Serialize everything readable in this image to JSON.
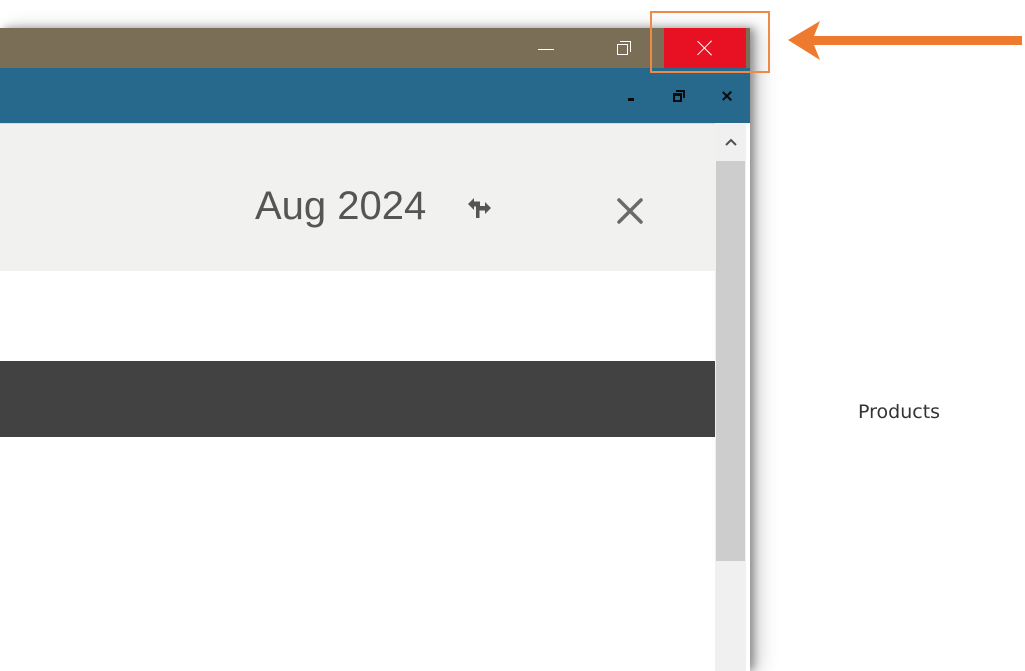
{
  "window": {
    "minimize_icon": "minimize-icon",
    "restore_icon": "restore-icon",
    "close_icon": "close-icon",
    "close_color": "#e81123",
    "titlebar_color": "#7b6e57"
  },
  "inner_window": {
    "bar_color": "#26698c",
    "minimize_icon": "minimize-icon",
    "restore_icon": "restore-icon",
    "close_icon": "close-icon"
  },
  "panel": {
    "period": "Aug 2024",
    "swap_icon": "swap-arrows-icon",
    "close_icon": "close-icon",
    "header_color": "#f1f1ef",
    "dark_bar_color": "#424242"
  },
  "content": {
    "products_label": "Products"
  },
  "scrollbar": {
    "up_icon": "chevron-up-icon"
  },
  "annotation": {
    "color": "#ee8a48",
    "arrow_icon": "arrow-left-icon"
  }
}
